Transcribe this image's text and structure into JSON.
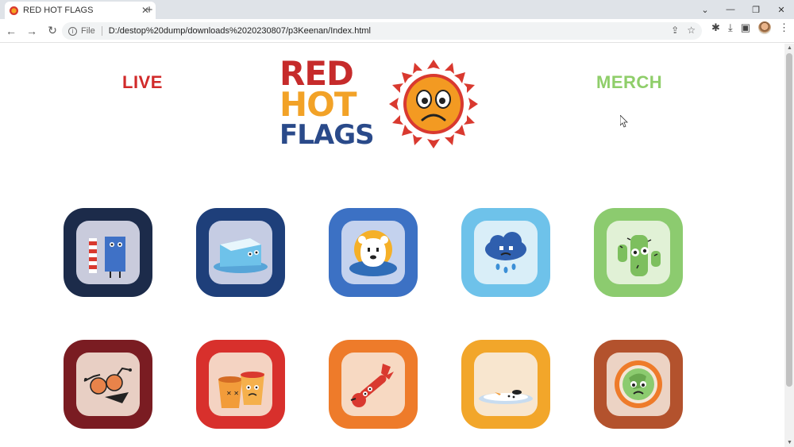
{
  "browser": {
    "tab_title": "RED HOT FLAGS",
    "tab_close": "✕",
    "new_tab": "+",
    "scheme": "File",
    "url": "D:/destop%20dump/downloads%2020230807/p3Keenan/Index.html"
  },
  "page": {
    "nav": {
      "live": "LIVE",
      "merch": "MERCH"
    },
    "logo": {
      "line1": "RED",
      "line2": "HOT",
      "line3": "FLAGS"
    }
  },
  "icons": [
    {
      "name": "hot-cold-icon",
      "outer": "#1c2b4a",
      "inner": "#c9cbdc"
    },
    {
      "name": "melting-ice-icon",
      "outer": "#1e3f7a",
      "inner": "#c5cce3"
    },
    {
      "name": "polar-bear-icon",
      "outer": "#3c71c4",
      "inner": "#c4d2ee"
    },
    {
      "name": "rain-cloud-icon",
      "outer": "#6ec2ea",
      "inner": "#d9eef8"
    },
    {
      "name": "cactus-icon",
      "outer": "#8ccb6f",
      "inner": "#e1f1d6"
    },
    {
      "name": "bugs-icon",
      "outer": "#7a1c22",
      "inner": "#e8cfc4"
    },
    {
      "name": "cups-icon",
      "outer": "#d8302c",
      "inner": "#f4d3c2"
    },
    {
      "name": "thermometer-icon",
      "outer": "#ee7b2a",
      "inner": "#f7d9c2"
    },
    {
      "name": "melted-snowman-icon",
      "outer": "#f2a62a",
      "inner": "#f8e6cf"
    },
    {
      "name": "burning-earth-icon",
      "outer": "#b3522d",
      "inner": "#ecd3c4"
    }
  ]
}
